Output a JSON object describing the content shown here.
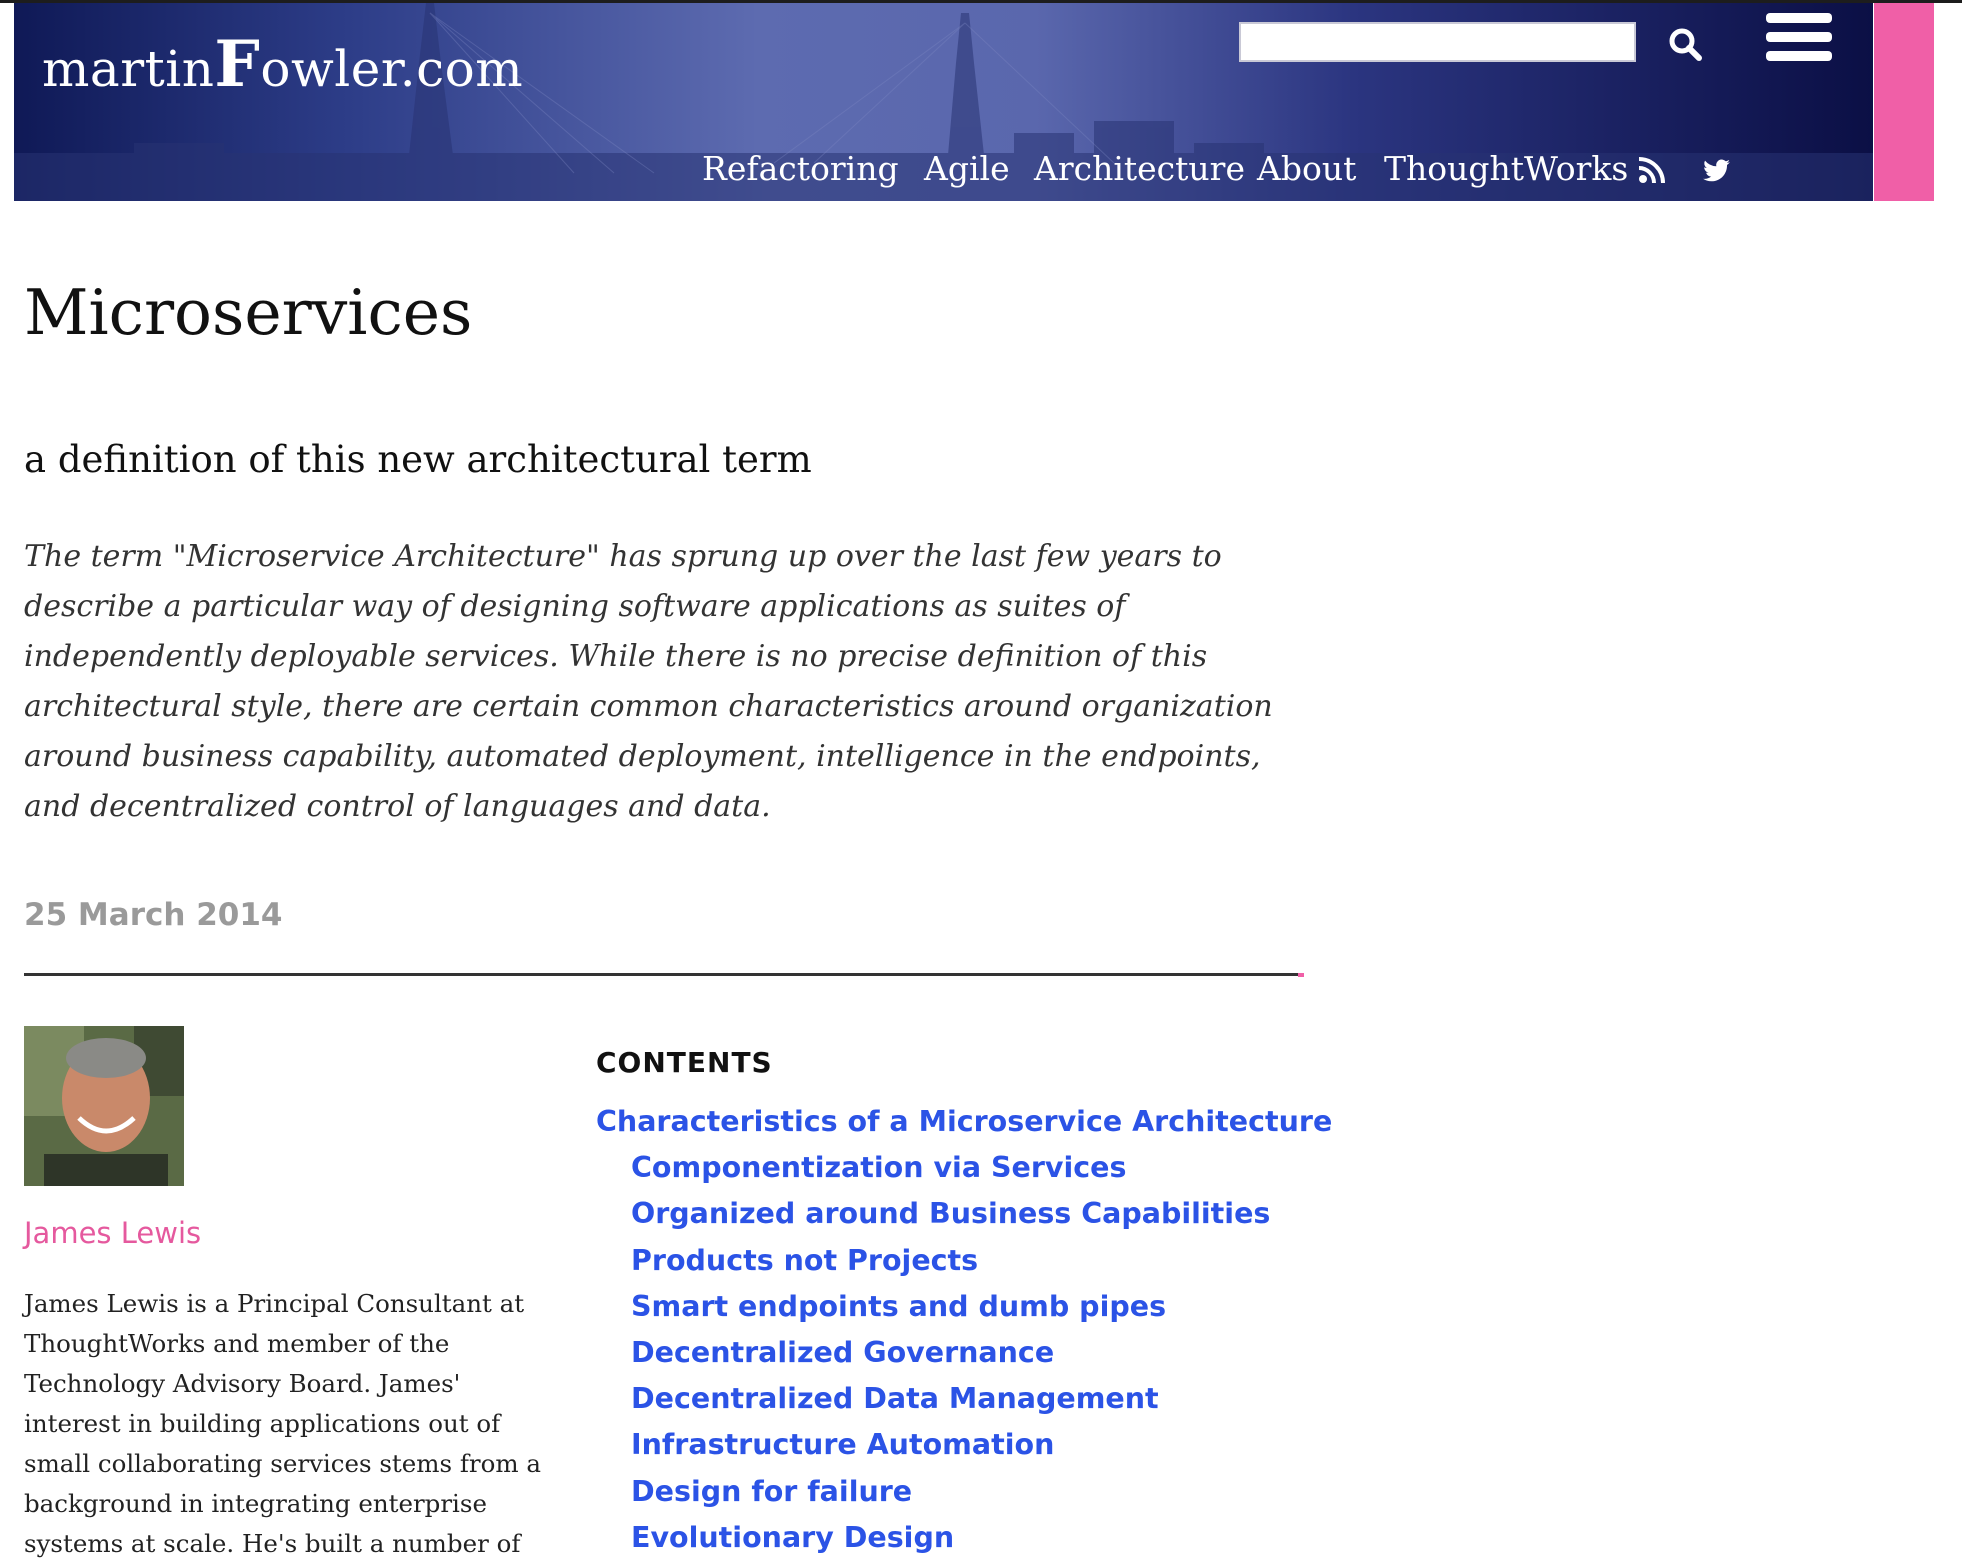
{
  "header": {
    "logo_small_1": "martin",
    "logo_big": "F",
    "logo_small_2": "owler.com",
    "search": {
      "value": "",
      "placeholder": ""
    },
    "nav": [
      "Refactoring",
      "Agile",
      "Architecture",
      "About",
      "ThoughtWorks"
    ],
    "icons": {
      "search": "search-icon",
      "menu": "hamburger-menu-icon",
      "rss": "rss-icon",
      "twitter": "twitter-icon"
    },
    "colors": {
      "banner": "#2d3d88",
      "accent": "#f05fa7"
    }
  },
  "article": {
    "title": "Microservices",
    "subtitle": "a definition of this new architectural term",
    "abstract": "The term \"Microservice Architecture\" has sprung up over the last few years to describe a particular way of designing software applications as suites of independently deployable services. While there is no precise definition of this architectural style, there are certain common characteristics around organization around business capability, automated deployment, intelligence in the endpoints, and decentralized control of languages and data.",
    "date": "25 March 2014"
  },
  "author": {
    "name": "James Lewis",
    "bio": "James Lewis is a Principal Consultant at ThoughtWorks and member of the Technology Advisory Board. James' interest in building applications out of small collaborating services stems from a background in integrating enterprise systems at scale. He's built a number of"
  },
  "contents": {
    "heading": "CONTENTS",
    "items": [
      {
        "label": "Characteristics of a Microservice Architecture",
        "level": 1
      },
      {
        "label": "Componentization via Services",
        "level": 2
      },
      {
        "label": "Organized around Business Capabilities",
        "level": 2
      },
      {
        "label": "Products not Projects",
        "level": 2
      },
      {
        "label": "Smart endpoints and dumb pipes",
        "level": 2
      },
      {
        "label": "Decentralized Governance",
        "level": 2
      },
      {
        "label": "Decentralized Data Management",
        "level": 2
      },
      {
        "label": "Infrastructure Automation",
        "level": 2
      },
      {
        "label": "Design for failure",
        "level": 2
      },
      {
        "label": "Evolutionary Design",
        "level": 2
      }
    ]
  }
}
